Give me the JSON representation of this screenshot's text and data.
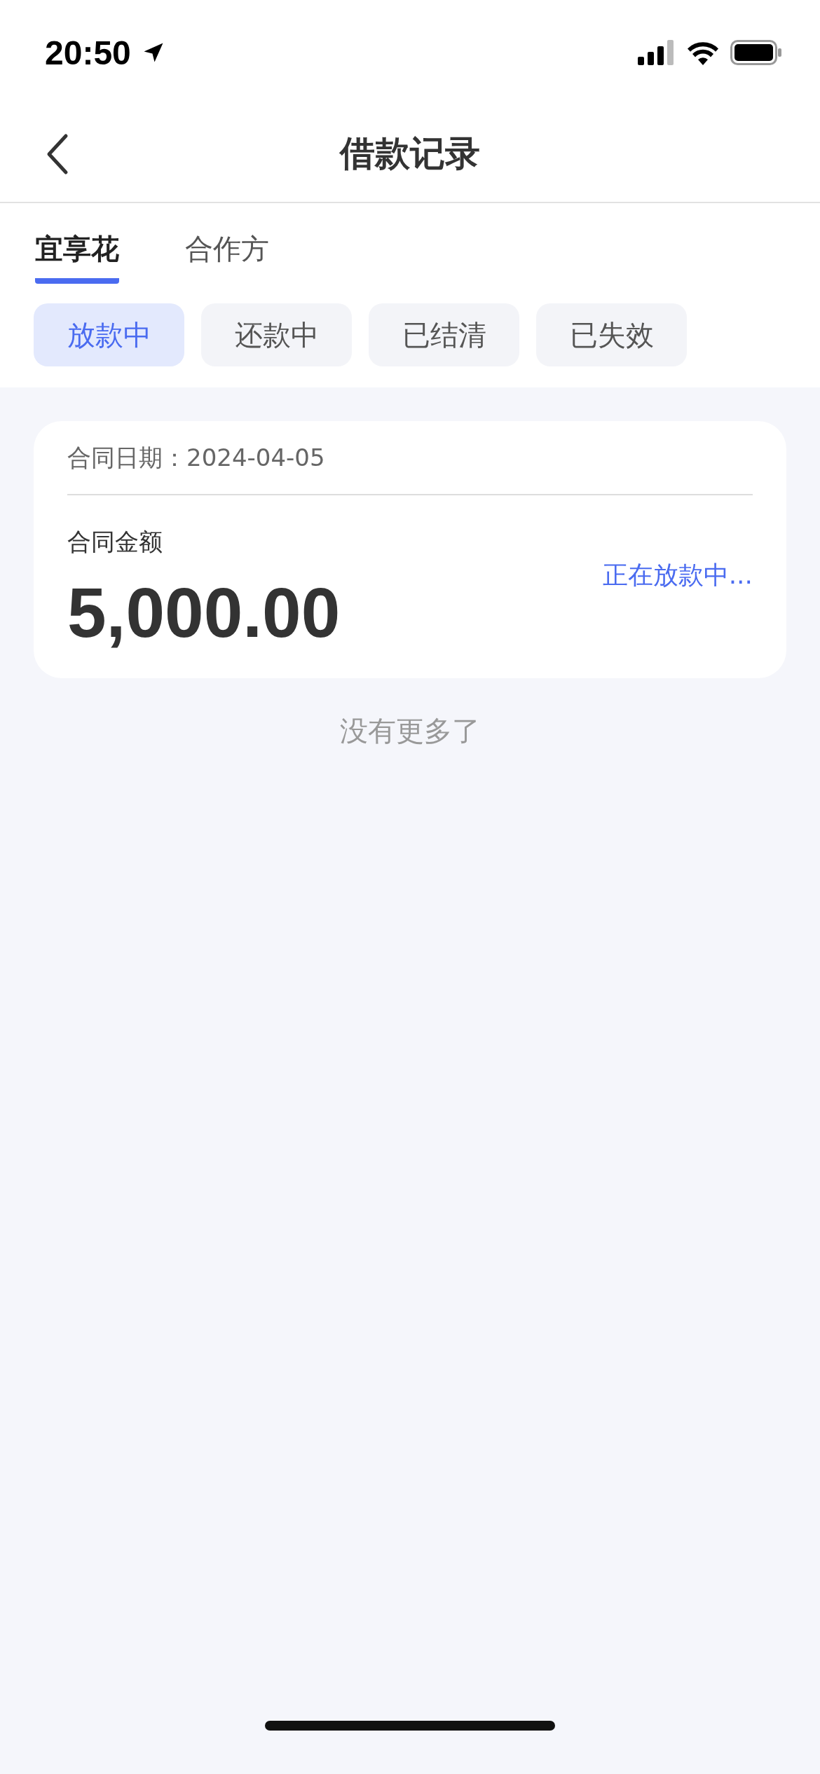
{
  "status_bar": {
    "time": "20:50"
  },
  "nav": {
    "title": "借款记录"
  },
  "tabs": [
    {
      "label": "宜享花",
      "selected": true
    },
    {
      "label": "合作方",
      "selected": false
    }
  ],
  "filters": [
    {
      "label": "放款中",
      "selected": true
    },
    {
      "label": "还款中",
      "selected": false
    },
    {
      "label": "已结清",
      "selected": false
    },
    {
      "label": "已失效",
      "selected": false
    }
  ],
  "records": [
    {
      "date_label": "合同日期：",
      "date": "2024-04-05",
      "amount_label": "合同金额",
      "amount": "5,000.00",
      "status": "正在放款中..."
    }
  ],
  "footer_text": "没有更多了"
}
